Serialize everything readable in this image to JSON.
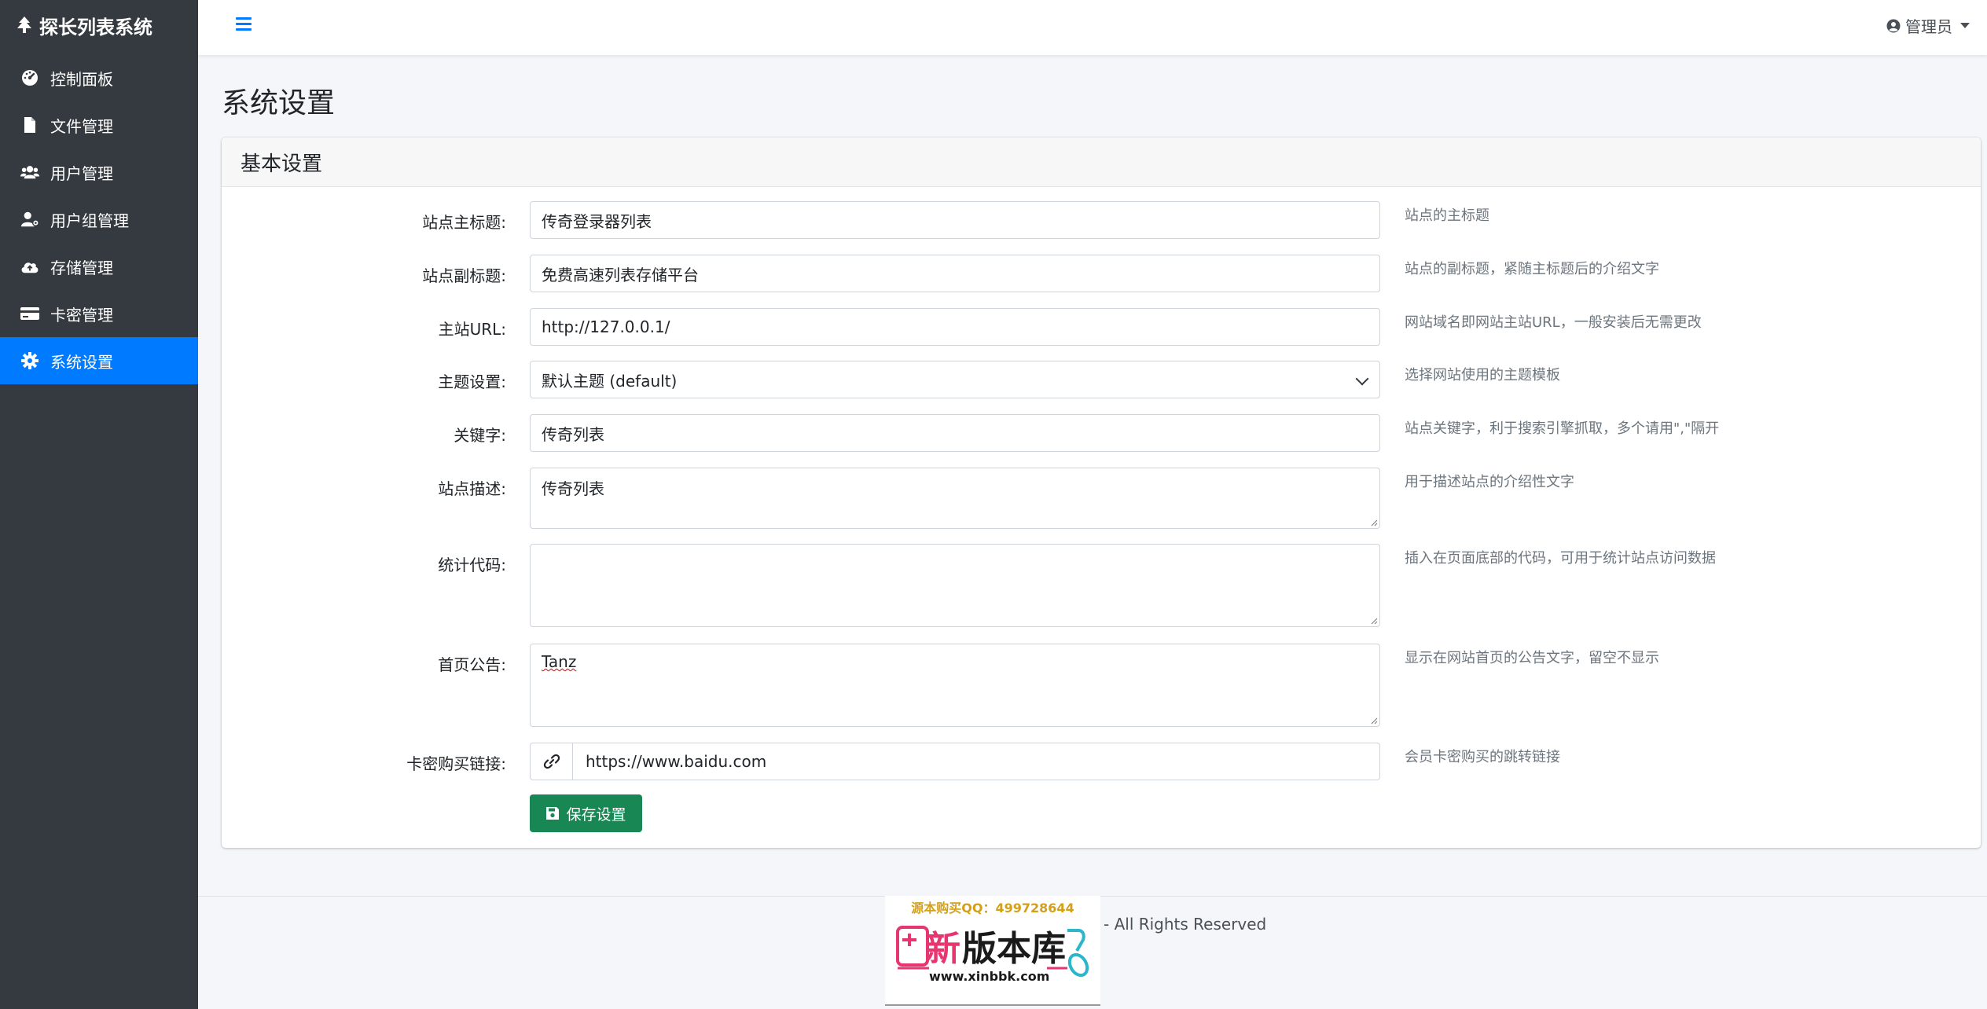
{
  "brand": {
    "title": "探长列表系统"
  },
  "sidebar": {
    "items": [
      {
        "label": "控制面板",
        "icon": "gauge-icon"
      },
      {
        "label": "文件管理",
        "icon": "file-icon"
      },
      {
        "label": "用户管理",
        "icon": "users-icon"
      },
      {
        "label": "用户组管理",
        "icon": "user-gear-icon"
      },
      {
        "label": "存储管理",
        "icon": "cloud-upload-icon"
      },
      {
        "label": "卡密管理",
        "icon": "credit-card-icon"
      },
      {
        "label": "系统设置",
        "icon": "gear-icon",
        "active": true
      }
    ]
  },
  "topbar": {
    "user_label": "管理员"
  },
  "page": {
    "title": "系统设置"
  },
  "card": {
    "header": "基本设置",
    "fields": {
      "site_title": {
        "label": "站点主标题:",
        "value": "传奇登录器列表",
        "help": "站点的主标题"
      },
      "site_subtitle": {
        "label": "站点副标题:",
        "value": "免费高速列表存储平台",
        "help": "站点的副标题，紧随主标题后的介绍文字"
      },
      "site_url": {
        "label": "主站URL:",
        "value": "http://127.0.0.1/",
        "help": "网站域名即网站主站URL，一般安装后无需更改"
      },
      "theme": {
        "label": "主题设置:",
        "value": "默认主题 (default)",
        "help": "选择网站使用的主题模板"
      },
      "keywords": {
        "label": "关键字:",
        "value": "传奇列表",
        "help": "站点关键字，利于搜索引擎抓取，多个请用\",\"隔开"
      },
      "description": {
        "label": "站点描述:",
        "value": "传奇列表",
        "help": "用于描述站点的介绍性文字"
      },
      "stats_code": {
        "label": "统计代码:",
        "value": "",
        "help": "插入在页面底部的代码，可用于统计站点访问数据"
      },
      "notice": {
        "label": "首页公告:",
        "value": "Tanz",
        "help": "显示在网站首页的公告文字，留空不显示"
      },
      "card_link": {
        "label": "卡密购买链接:",
        "value": "https://www.baidu.com",
        "help": "会员卡密购买的跳转链接"
      }
    },
    "save_label": "保存设置"
  },
  "footer": {
    "text": "- All Rights Reserved"
  },
  "watermark": {
    "qq": "源本购买QQ：499728644",
    "brand": "新版本库",
    "url": "www.xinbbk.com"
  }
}
